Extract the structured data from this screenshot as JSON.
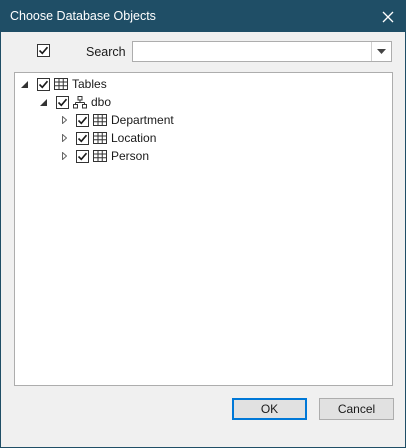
{
  "window": {
    "title": "Choose Database Objects"
  },
  "search": {
    "label": "Search",
    "value": "",
    "placeholder": "",
    "checked": true
  },
  "tree": {
    "root": {
      "label": "Tables",
      "checked": true,
      "expanded": true
    },
    "schema": {
      "label": "dbo",
      "checked": true,
      "expanded": true
    },
    "items": [
      {
        "label": "Department",
        "checked": true,
        "expanded": false
      },
      {
        "label": "Location",
        "checked": true,
        "expanded": false
      },
      {
        "label": "Person",
        "checked": true,
        "expanded": false
      }
    ]
  },
  "buttons": {
    "ok": "OK",
    "cancel": "Cancel"
  },
  "colors": {
    "titlebar": "#1f4e66",
    "default_button_border": "#0078d7"
  }
}
